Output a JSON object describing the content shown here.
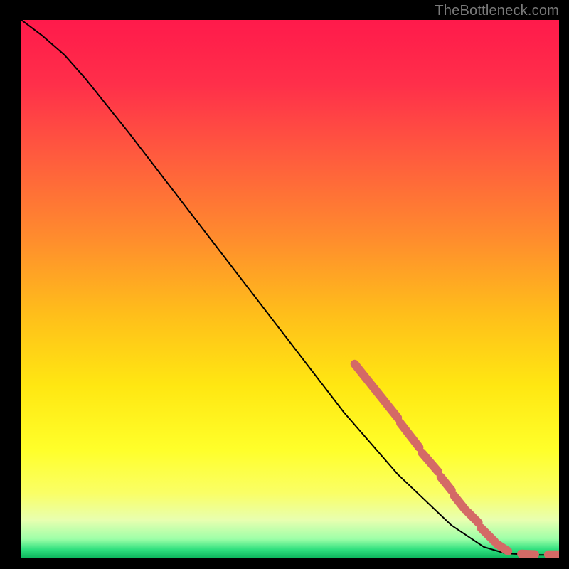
{
  "watermark": "TheBottleneck.com",
  "chart_data": {
    "type": "line",
    "title": "",
    "xlabel": "",
    "ylabel": "",
    "xlim": [
      0,
      100
    ],
    "ylim": [
      0,
      100
    ],
    "grid": false,
    "legend": false,
    "curve": [
      {
        "x": 0,
        "y": 100
      },
      {
        "x": 4,
        "y": 97
      },
      {
        "x": 8,
        "y": 93.5
      },
      {
        "x": 12,
        "y": 89
      },
      {
        "x": 20,
        "y": 79
      },
      {
        "x": 30,
        "y": 66
      },
      {
        "x": 40,
        "y": 53
      },
      {
        "x": 50,
        "y": 40
      },
      {
        "x": 60,
        "y": 27
      },
      {
        "x": 70,
        "y": 15.5
      },
      {
        "x": 80,
        "y": 6
      },
      {
        "x": 86,
        "y": 2
      },
      {
        "x": 90,
        "y": 0.8
      },
      {
        "x": 95,
        "y": 0.5
      },
      {
        "x": 100,
        "y": 0.5
      }
    ],
    "dot_segments": [
      {
        "x1": 62,
        "y1": 36,
        "x2": 70,
        "y2": 26
      },
      {
        "x1": 70.5,
        "y1": 25,
        "x2": 74,
        "y2": 20.5
      },
      {
        "x1": 74.5,
        "y1": 19.5,
        "x2": 77.5,
        "y2": 16
      },
      {
        "x1": 78,
        "y1": 15,
        "x2": 80,
        "y2": 12.5
      },
      {
        "x1": 80.5,
        "y1": 11.5,
        "x2": 82.5,
        "y2": 9
      },
      {
        "x1": 83,
        "y1": 8.5,
        "x2": 85,
        "y2": 6.5
      },
      {
        "x1": 85.5,
        "y1": 5.5,
        "x2": 88,
        "y2": 3
      },
      {
        "x1": 88.5,
        "y1": 2.5,
        "x2": 90.5,
        "y2": 1.2
      },
      {
        "x1": 93,
        "y1": 0.7,
        "x2": 95.5,
        "y2": 0.6
      },
      {
        "x1": 98,
        "y1": 0.55,
        "x2": 100,
        "y2": 0.55
      }
    ],
    "gradient_stops": [
      {
        "offset": 0,
        "color": "#ff1a4b"
      },
      {
        "offset": 0.12,
        "color": "#ff2f4a"
      },
      {
        "offset": 0.25,
        "color": "#ff5a3e"
      },
      {
        "offset": 0.4,
        "color": "#ff8a2e"
      },
      {
        "offset": 0.55,
        "color": "#ffbf1a"
      },
      {
        "offset": 0.68,
        "color": "#ffe712"
      },
      {
        "offset": 0.8,
        "color": "#ffff2a"
      },
      {
        "offset": 0.88,
        "color": "#faff66"
      },
      {
        "offset": 0.93,
        "color": "#e8ffb0"
      },
      {
        "offset": 0.965,
        "color": "#9effa8"
      },
      {
        "offset": 0.985,
        "color": "#2fe07e"
      },
      {
        "offset": 1.0,
        "color": "#0fb85f"
      }
    ],
    "dot_color": "#d46a66",
    "line_color": "#000000"
  }
}
